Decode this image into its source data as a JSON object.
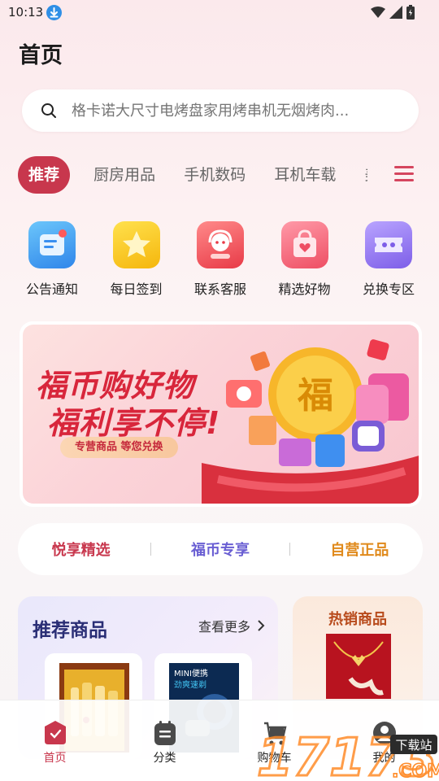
{
  "status_bar": {
    "time": "10:13"
  },
  "header": {
    "title": "首页"
  },
  "search": {
    "placeholder": "格卡诺大尺寸电烤盘家用烤串机无烟烤肉..."
  },
  "category_tabs": [
    {
      "label": "推荐",
      "active": true
    },
    {
      "label": "厨房用品"
    },
    {
      "label": "手机数码"
    },
    {
      "label": "耳机车载"
    },
    {
      "label": "美"
    }
  ],
  "quick_entries": [
    {
      "label": "公告通知",
      "icon": "announcement-icon",
      "color": "#3a9ef0"
    },
    {
      "label": "每日签到",
      "icon": "star-checkin-icon",
      "color": "#f7c21a"
    },
    {
      "label": "联系客服",
      "icon": "customer-service-icon",
      "color": "#f0525d"
    },
    {
      "label": "精选好物",
      "icon": "shopping-bag-icon",
      "color": "#f26676"
    },
    {
      "label": "兑换专区",
      "icon": "ticket-icon",
      "color": "#8f73ef"
    }
  ],
  "banner": {
    "line1": "福币购好物",
    "line2": "福利享不停!",
    "pill": "专营商品  等您兑换",
    "coin_char": "福"
  },
  "highlights": [
    {
      "label": "悦享精选",
      "color": "#c8374d"
    },
    {
      "label": "福币专享",
      "color": "#6a5fd3"
    },
    {
      "label": "自营正品",
      "color": "#e08a1c"
    }
  ],
  "recommend": {
    "title": "推荐商品",
    "more": "查看更多",
    "products": [
      {
        "name": "liquor-gift-box"
      },
      {
        "name": "mini-portable-device",
        "tag": "MINI便携",
        "sub": "劲爽速剃"
      }
    ]
  },
  "hot": {
    "title": "热销商品"
  },
  "bottom_nav": [
    {
      "label": "首页",
      "active": true
    },
    {
      "label": "分类"
    },
    {
      "label": "购物车"
    },
    {
      "label": "我的"
    }
  ],
  "watermark": {
    "text": "17173",
    "sub": "下载站",
    "domain": ".COM"
  },
  "colors": {
    "primary": "#c8374d",
    "accent_purple": "#6a5fd3",
    "accent_orange": "#e08a1c"
  }
}
